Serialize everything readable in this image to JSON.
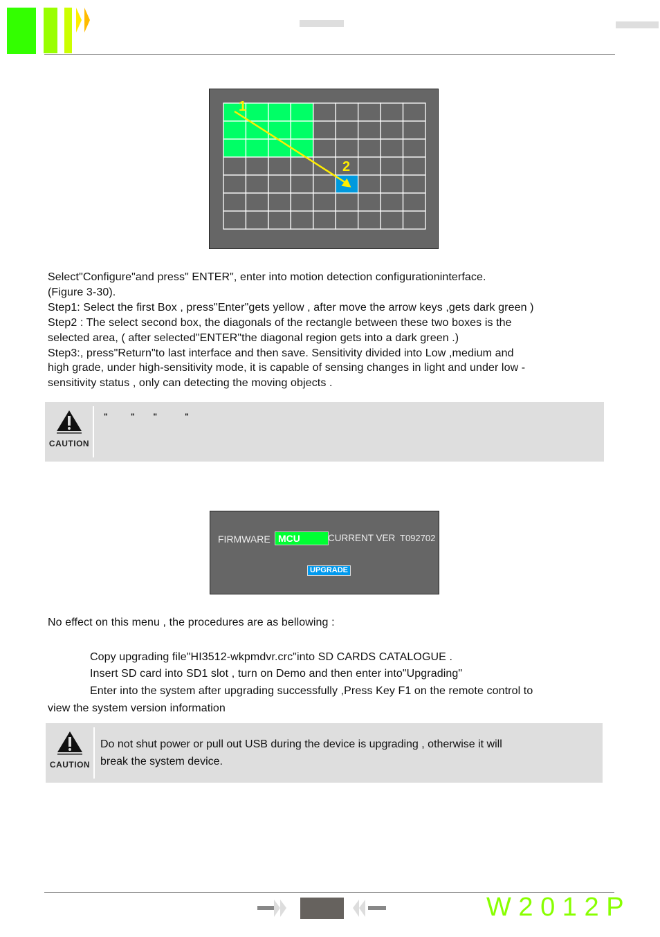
{
  "header": {
    "brand_colors": [
      "#33ff00",
      "#99ff00",
      "#ccff00",
      "#ffee00",
      "#ffbb00"
    ]
  },
  "motion_grid": {
    "cols": 9,
    "rows": 7,
    "selected_green": {
      "cols": [
        0,
        3
      ],
      "rows": [
        0,
        2
      ]
    },
    "selected_blue": {
      "col": 5,
      "row": 4
    },
    "label_1": "1",
    "label_2": "2",
    "green": "#00ff66",
    "blue": "#0099dd",
    "arrow": "#ffee00"
  },
  "para1": [
    "Select\"Configure\"and press\" ENTER\", enter into motion detection configurationinterface.",
    "(Figure  3-30).",
    "Step1: Select the first Box , press\"Enter\"gets yellow , after move the arrow keys ,gets dark green )",
    "Step2 : The select second box, the diagonals of the rectangle between these two boxes is the",
    "selected area, ( after selected\"ENTER\"the diagonal region gets into a dark green .)",
    "Step3:, press\"Return\"to last interface and then save. Sensitivity divided into Low ,medium and",
    "high grade, under high-sensitivity mode, it is capable of  sensing changes in light and under low  -",
    "sensitivity status , only can detecting the moving objects ."
  ],
  "caution1": {
    "label": "CAUTION",
    "text": "\"          \"        \"            \""
  },
  "firmware": {
    "label": "FIRMWARE",
    "value": "MCU",
    "current_ver_label": "CURRENT VER",
    "current_ver": "T092702",
    "upgrade_button": "UPGRADE"
  },
  "para2": "No effect on this menu , the  procedures are as bellowing :",
  "steps": [
    "Copy upgrading file\"HI3512-wkpmdvr.crc\"into SD CARDS CATALOGUE .",
    "Insert SD card into SD1 slot , turn on Demo and then enter into\"Upgrading\"",
    "Enter into the system after upgrading  successfully ,Press Key F1 on the remote control to"
  ],
  "steps_cont": "view the system version information",
  "caution2": {
    "label": "CAUTION",
    "lines": [
      "Do not shut power or pull out USB during the device is upgrading , otherwise it will",
      "break the system device."
    ]
  },
  "footer": {
    "model": "W 2 0 1 2 P",
    "model_color": "#88ff00"
  }
}
